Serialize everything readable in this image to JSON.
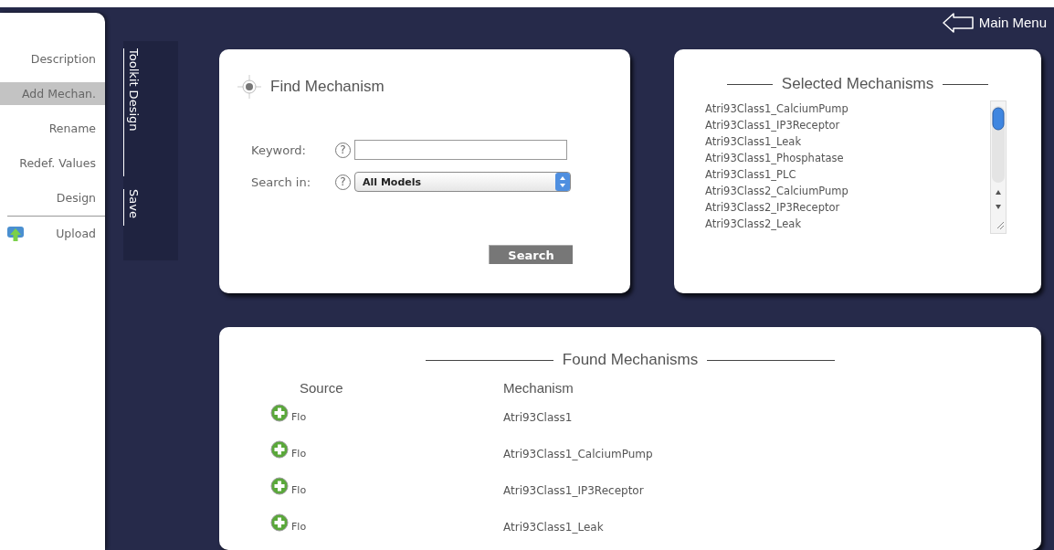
{
  "sidebar": {
    "items": [
      {
        "label": "Description",
        "selected": false,
        "kind": "text"
      },
      {
        "label": "Add Mechan.",
        "selected": true,
        "kind": "text"
      },
      {
        "label": "Rename",
        "selected": false,
        "kind": "text"
      },
      {
        "label": "Redef. Values",
        "selected": false,
        "kind": "text"
      },
      {
        "label": "Design",
        "selected": false,
        "kind": "text"
      },
      {
        "label": "Upload",
        "selected": false,
        "kind": "upload"
      }
    ]
  },
  "side_tabs": [
    "Toolkit Design",
    "Save"
  ],
  "header": {
    "main_menu": "Main Menu"
  },
  "find_panel": {
    "title": "Find Mechanism",
    "keyword_label": "Keyword:",
    "search_in_label": "Search in:",
    "help": "?",
    "search_in_value": "All Models",
    "search_button": "Search"
  },
  "selected_panel": {
    "title": "Selected Mechanisms",
    "items": [
      "Atri93Class1_CalciumPump",
      "Atri93Class1_IP3Receptor",
      "Atri93Class1_Leak",
      "Atri93Class1_Phosphatase",
      "Atri93Class1_PLC",
      "Atri93Class2_CalciumPump",
      "Atri93Class2_IP3Receptor",
      "Atri93Class2_Leak"
    ]
  },
  "found_panel": {
    "title": "Found Mechanisms",
    "columns": [
      "Source",
      "Mechanism"
    ],
    "rows": [
      {
        "source": "Flo",
        "mechanism": "Atri93Class1"
      },
      {
        "source": "Flo",
        "mechanism": "Atri93Class1_CalciumPump"
      },
      {
        "source": "Flo",
        "mechanism": "Atri93Class1_IP3Receptor"
      },
      {
        "source": "Flo",
        "mechanism": "Atri93Class1_Leak"
      }
    ]
  }
}
